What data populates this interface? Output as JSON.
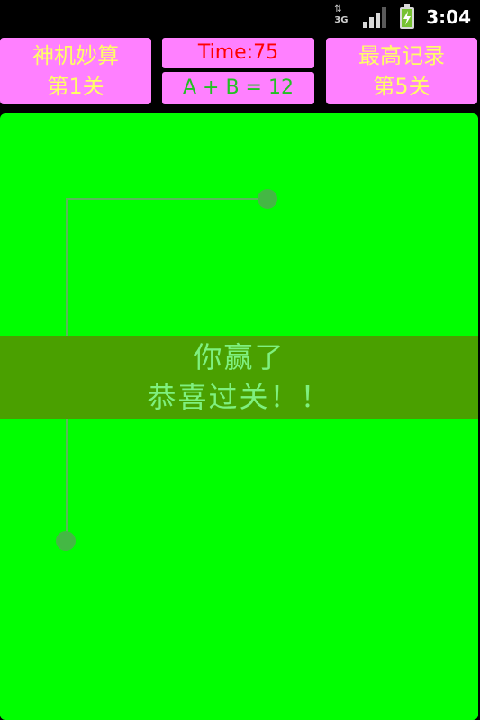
{
  "status_bar": {
    "network_type": "3G",
    "time": "3:04",
    "icons": [
      "data-transfer-icon",
      "signal-strength-icon",
      "battery-charging-icon"
    ]
  },
  "hud": {
    "game_title": "神机妙算",
    "current_level": "第1关",
    "timer": "Time:75",
    "equation": "A + B = 12",
    "best_record_label": "最高记录",
    "best_level": "第5关"
  },
  "result": {
    "line1": "你赢了",
    "line2": "恭喜过关！！"
  },
  "colors": {
    "board": "#00ff00",
    "banner": "#4aa000",
    "banner_text": "#7ff07f",
    "hud_bg": "#ff80ff",
    "hud_text": "#ffff66",
    "timer_text": "#ff0000",
    "equation_text": "#22c022"
  }
}
